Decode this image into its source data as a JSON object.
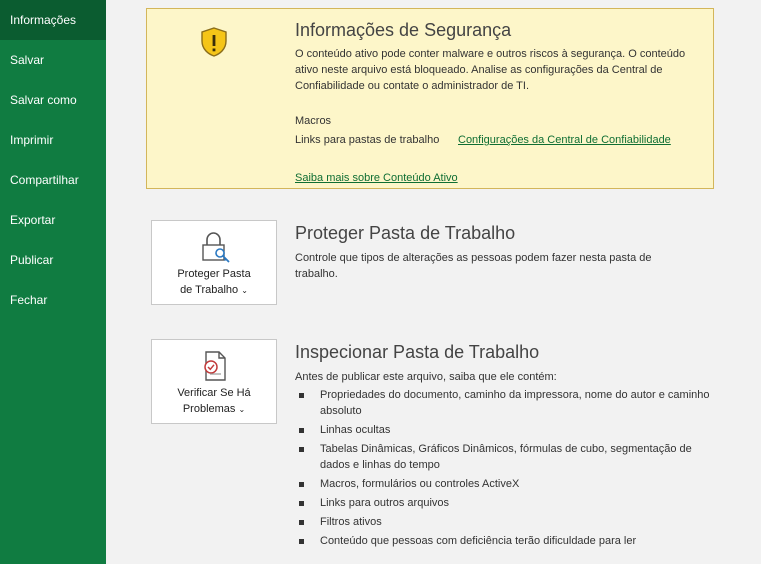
{
  "sidebar": {
    "items": [
      {
        "label": "Informações",
        "active": true
      },
      {
        "label": "Salvar"
      },
      {
        "label": "Salvar como"
      },
      {
        "label": "Imprimir"
      },
      {
        "label": "Compartilhar"
      },
      {
        "label": "Exportar"
      },
      {
        "label": "Publicar"
      },
      {
        "label": "Fechar"
      }
    ]
  },
  "security": {
    "icon": "shield-warning-icon",
    "title": "Informações de Segurança",
    "text": "O conteúdo ativo pode conter malware e outros riscos à segurança. O conteúdo ativo neste arquivo está bloqueado. Analise as configurações da Central de Confiabilidade ou contate o administrador de TI.",
    "macros_label": "Macros",
    "links_label": "Links para pastas de trabalho",
    "trust_center_link": "Configurações da Central de Confiabilidade",
    "learn_more_link": "Saiba mais sobre Conteúdo Ativo"
  },
  "protect": {
    "icon": "lock-key-icon",
    "button_line1": "Proteger Pasta",
    "button_line2": "de Trabalho",
    "title": "Proteger Pasta de Trabalho",
    "description": "Controle que tipos de alterações as pessoas podem fazer nesta pasta de trabalho."
  },
  "inspect": {
    "icon": "check-document-icon",
    "button_line1": "Verificar Se Há",
    "button_line2": "Problemas",
    "title": "Inspecionar Pasta de Trabalho",
    "intro": "Antes de publicar este arquivo, saiba que ele contém:",
    "items": [
      "Propriedades do documento, caminho da impressora, nome do autor e caminho absoluto",
      "Linhas ocultas",
      "Tabelas Dinâmicas, Gráficos Dinâmicos, fórmulas de cubo, segmentação de dados e linhas do tempo",
      "Macros, formulários ou controles ActiveX",
      "Links para outros arquivos",
      "Filtros ativos",
      "Conteúdo que pessoas com deficiência terão dificuldade para ler"
    ]
  },
  "chevron": "⌄",
  "colors": {
    "sidebar": "#107c41",
    "sidebar_active": "#0b5c30",
    "warning_bg": "#fdf6c9",
    "link": "#0f6e33"
  }
}
